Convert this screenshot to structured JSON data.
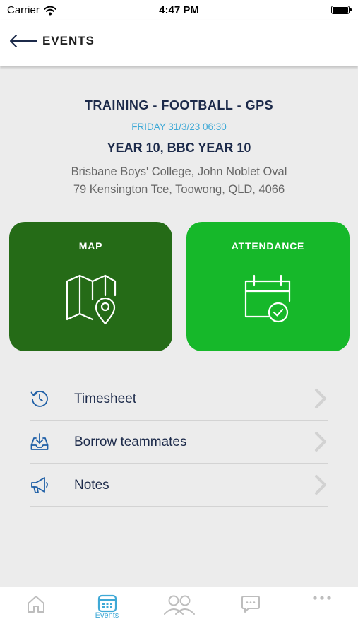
{
  "status_bar": {
    "carrier": "Carrier",
    "time": "4:47 PM"
  },
  "nav": {
    "title": "EVENTS"
  },
  "event": {
    "title": "TRAINING - FOOTBALL - GPS",
    "datetime": "FRIDAY 31/3/23 06:30",
    "group": "YEAR 10, BBC YEAR 10",
    "venue": "Brisbane Boys' College, John Noblet Oval",
    "address": "79 Kensington Tce, Toowong, QLD, 4066"
  },
  "tiles": [
    {
      "label": "MAP",
      "color": "#256b17",
      "icon": "map-pin-icon"
    },
    {
      "label": "ATTENDANCE",
      "color": "#16b82a",
      "icon": "calendar-check-icon"
    }
  ],
  "menu": [
    {
      "label": "Timesheet",
      "icon": "history-clock-icon"
    },
    {
      "label": "Borrow teammates",
      "icon": "inbox-download-icon"
    },
    {
      "label": "Notes",
      "icon": "megaphone-icon"
    }
  ],
  "tabs": [
    {
      "icon": "home-icon",
      "label": ""
    },
    {
      "icon": "calendar-grid-icon",
      "label": "Events",
      "active": true
    },
    {
      "icon": "people-icon",
      "label": ""
    },
    {
      "icon": "chat-bubble-icon",
      "label": ""
    },
    {
      "icon": "more-dots-icon",
      "label": ""
    }
  ],
  "colors": {
    "navy_text": "#1c2a4a",
    "accent_blue": "#3fa9d6",
    "map_green": "#256b17",
    "attendance_green": "#16b82a",
    "background": "#ececec"
  }
}
